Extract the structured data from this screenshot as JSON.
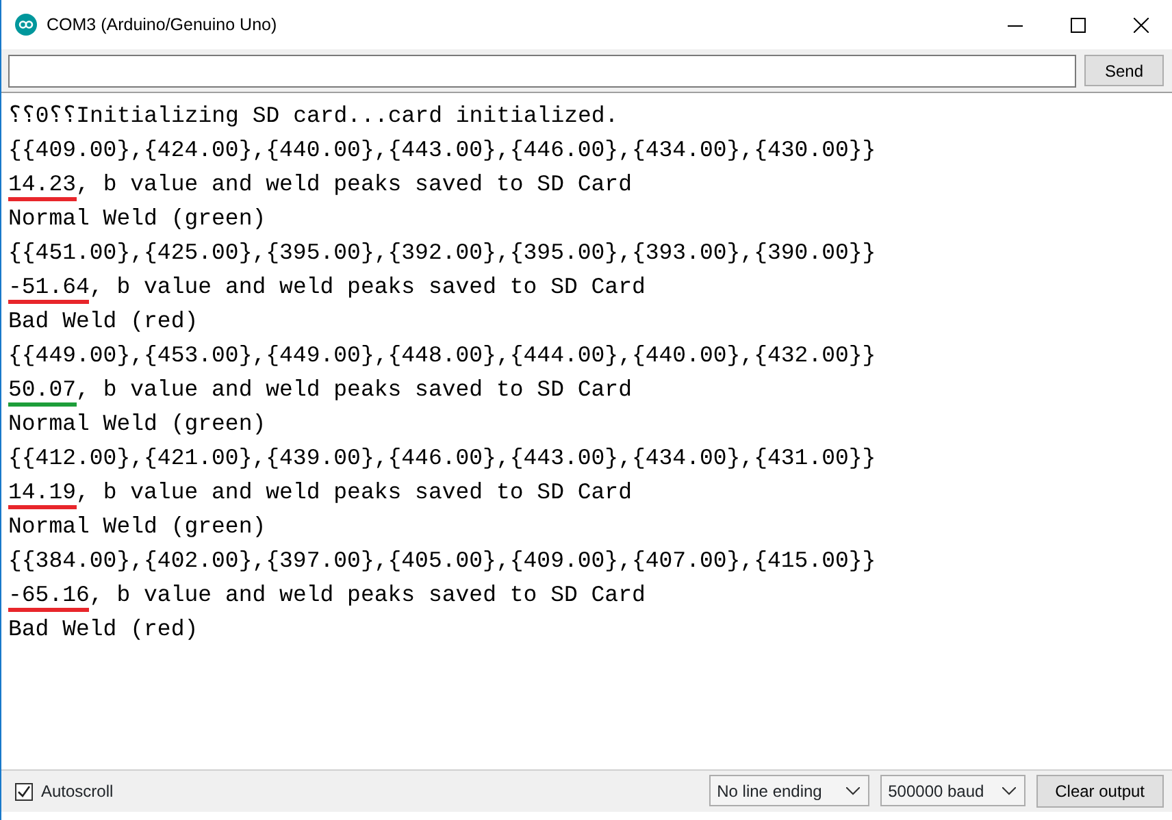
{
  "window": {
    "title": "COM3 (Arduino/Genuino Uno)"
  },
  "send_button": "Send",
  "output": [
    {
      "text": "⸮⸮0⸮⸮Initializing SD card...card initialized."
    },
    {
      "text": "{{409.00},{424.00},{440.00},{443.00},{446.00},{434.00},{430.00}}"
    },
    {
      "lead": "14.23",
      "text": ", b value and weld peaks saved to SD Card",
      "color": "#e8262b"
    },
    {
      "text": "Normal Weld (green)"
    },
    {
      "text": "{{451.00},{425.00},{395.00},{392.00},{395.00},{393.00},{390.00}}"
    },
    {
      "lead": "-51.64",
      "text": ", b value and weld peaks saved to SD Card",
      "color": "#e8262b"
    },
    {
      "text": "Bad Weld (red)"
    },
    {
      "text": "{{449.00},{453.00},{449.00},{448.00},{444.00},{440.00},{432.00}}"
    },
    {
      "lead": "50.07",
      "text": ", b value and weld peaks saved to SD Card",
      "color": "#1e9e3a"
    },
    {
      "text": "Normal Weld (green)"
    },
    {
      "text": "{{412.00},{421.00},{439.00},{446.00},{443.00},{434.00},{431.00}}"
    },
    {
      "lead": "14.19",
      "text": ", b value and weld peaks saved to SD Card",
      "color": "#e8262b"
    },
    {
      "text": "Normal Weld (green)"
    },
    {
      "text": "{{384.00},{402.00},{397.00},{405.00},{409.00},{407.00},{415.00}}"
    },
    {
      "lead": "-65.16",
      "text": ", b value and weld peaks saved to SD Card",
      "color": "#e8262b"
    },
    {
      "text": "Bad Weld (red)"
    }
  ],
  "autoscroll": {
    "label": "Autoscroll",
    "checked": true
  },
  "line_ending": "No line ending",
  "baud": "500000 baud",
  "clear_button": "Clear output"
}
